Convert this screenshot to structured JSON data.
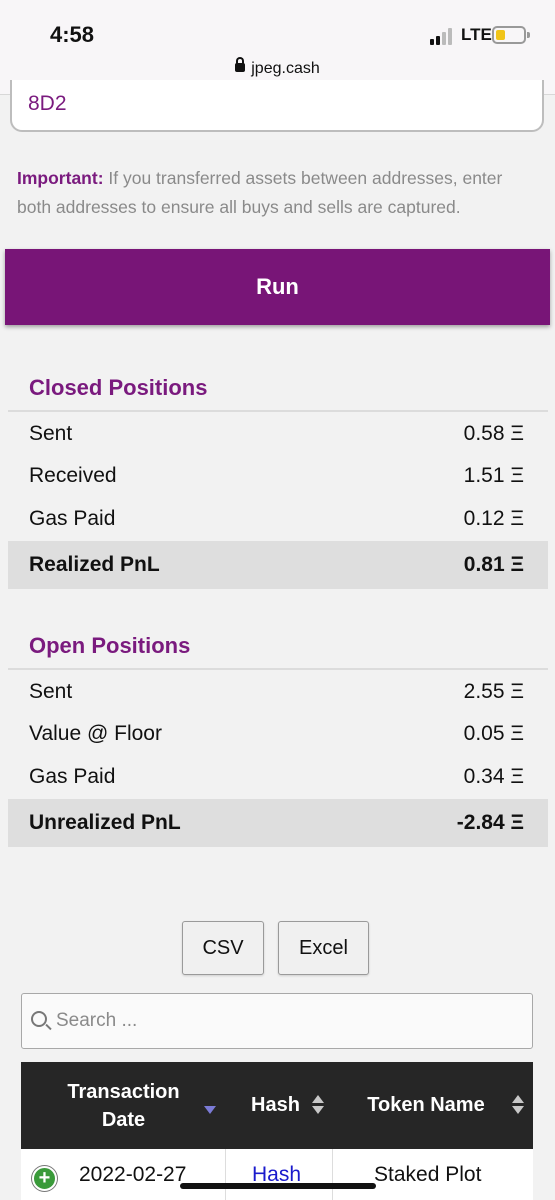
{
  "status_bar": {
    "time": "4:58",
    "network": "LTE",
    "url": "jpeg.cash"
  },
  "address_input": {
    "value": "8D2"
  },
  "notice": {
    "label": "Important:",
    "text": " If you transferred assets between addresses, enter both addresses to ensure all buys and sells are captured."
  },
  "run_button": {
    "label": "Run"
  },
  "closed_positions": {
    "title": "Closed Positions",
    "rows": [
      {
        "label": "Sent",
        "value": "0.58 Ξ"
      },
      {
        "label": "Received",
        "value": "1.51 Ξ"
      },
      {
        "label": "Gas Paid",
        "value": "0.12 Ξ"
      }
    ],
    "total": {
      "label": "Realized PnL",
      "value": "0.81 Ξ"
    }
  },
  "open_positions": {
    "title": "Open Positions",
    "rows": [
      {
        "label": "Sent",
        "value": "2.55 Ξ"
      },
      {
        "label": "Value @ Floor",
        "value": "0.05 Ξ"
      },
      {
        "label": "Gas Paid",
        "value": "0.34 Ξ"
      }
    ],
    "total": {
      "label": "Unrealized PnL",
      "value": "-2.84 Ξ"
    }
  },
  "export": {
    "csv_label": "CSV",
    "excel_label": "Excel"
  },
  "search": {
    "placeholder": "Search ..."
  },
  "table": {
    "headers": {
      "date": "Transaction Date",
      "hash": "Hash",
      "token": "Token Name"
    },
    "rows": [
      {
        "expand": "+",
        "date": "2022-02-27",
        "hash": "Hash",
        "token": "Staked Plot"
      }
    ]
  },
  "colors": {
    "brand": "#781577",
    "header": "#262626",
    "link": "#1a1acc"
  }
}
